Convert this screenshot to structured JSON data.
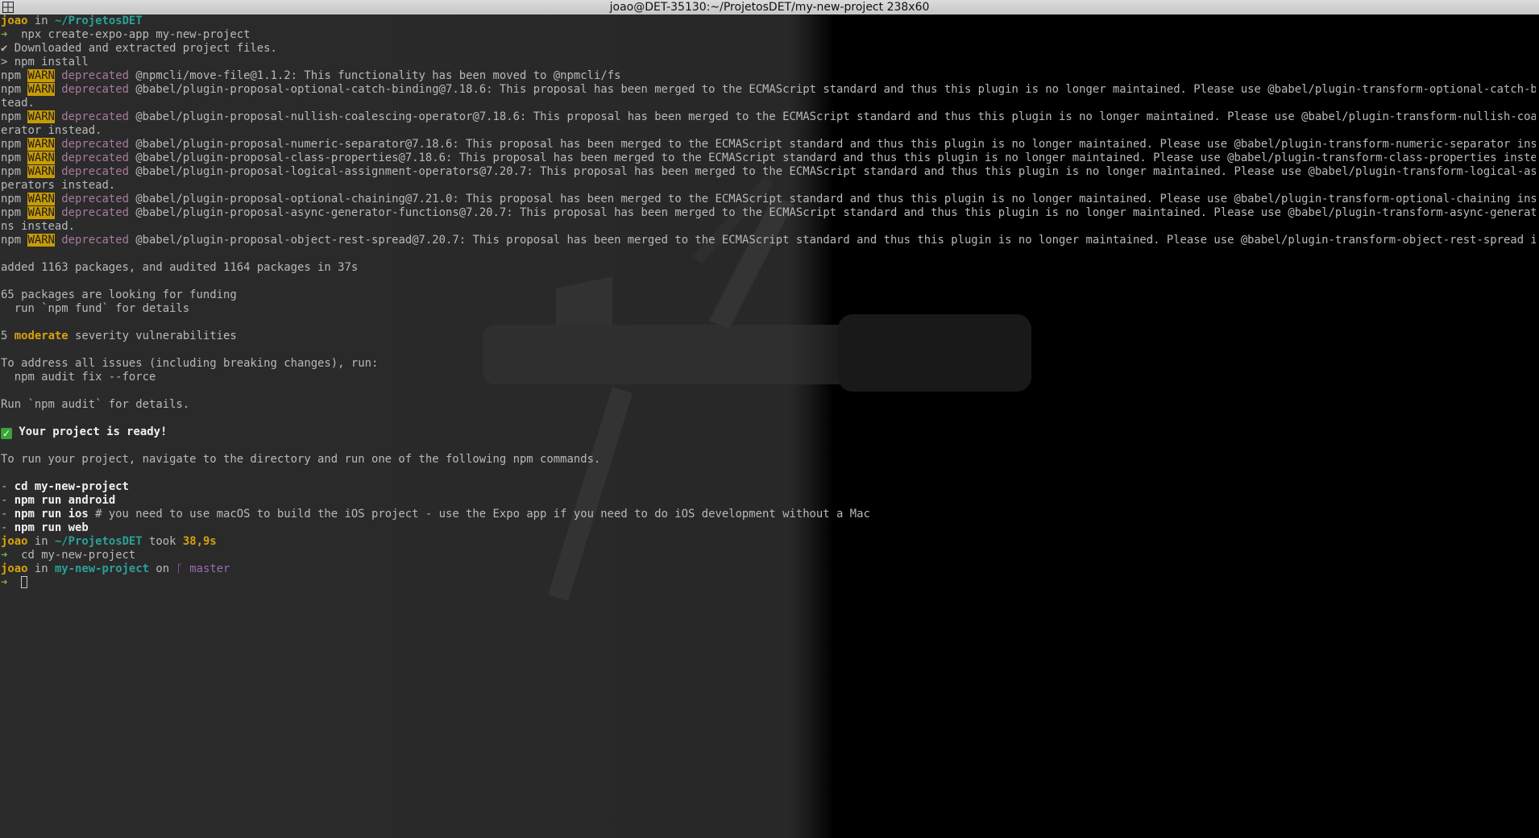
{
  "window": {
    "title": "joao@DET-35130:~/ProjetosDET/my-new-project 238x60"
  },
  "colors": {
    "prompt_user": "#d7a20a",
    "path": "#2aa198",
    "arrow": "#7fb04a",
    "warn_bg": "#c89b06",
    "deprecated": "#a87b9c",
    "branch": "#9b6bb3",
    "background": "#232323"
  },
  "prompt": {
    "user": "joao",
    "in_word": "in",
    "dir1": "~/ProjetosDET",
    "took_word": "took",
    "took_time": "38,9s",
    "dir2": "my-new-project",
    "on_word": "on",
    "branch_icon": "git-branch-icon",
    "branch": "master",
    "arrow": "➜"
  },
  "commands": {
    "create": "npx create-expo-app my-new-project",
    "cd": "cd my-new-project"
  },
  "output": {
    "downloaded": "✔ Downloaded and extracted project files.",
    "npm_install": "> npm install",
    "npm_prefix": "npm",
    "warn_label": "WARN",
    "deprecated_word": "deprecated",
    "warnings": [
      "@npmcli/move-file@1.1.2: This functionality has been moved to @npmcli/fs",
      "@babel/plugin-proposal-optional-catch-binding@7.18.6: This proposal has been merged to the ECMAScript standard and thus this plugin is no longer maintained. Please use @babel/plugin-transform-optional-catch-binding ins",
      "@babel/plugin-proposal-nullish-coalescing-operator@7.18.6: This proposal has been merged to the ECMAScript standard and thus this plugin is no longer maintained. Please use @babel/plugin-transform-nullish-coalescing-op",
      "@babel/plugin-proposal-numeric-separator@7.18.6: This proposal has been merged to the ECMAScript standard and thus this plugin is no longer maintained. Please use @babel/plugin-transform-numeric-separator instead.",
      "@babel/plugin-proposal-class-properties@7.18.6: This proposal has been merged to the ECMAScript standard and thus this plugin is no longer maintained. Please use @babel/plugin-transform-class-properties instead.",
      "@babel/plugin-proposal-logical-assignment-operators@7.20.7: This proposal has been merged to the ECMAScript standard and thus this plugin is no longer maintained. Please use @babel/plugin-transform-logical-assignment-o",
      "@babel/plugin-proposal-optional-chaining@7.21.0: This proposal has been merged to the ECMAScript standard and thus this plugin is no longer maintained. Please use @babel/plugin-transform-optional-chaining instead.",
      "@babel/plugin-proposal-async-generator-functions@7.20.7: This proposal has been merged to the ECMAScript standard and thus this plugin is no longer maintained. Please use @babel/plugin-transform-async-generator-functio",
      "@babel/plugin-proposal-object-rest-spread@7.20.7: This proposal has been merged to the ECMAScript standard and thus this plugin is no longer maintained. Please use @babel/plugin-transform-object-rest-spread instead."
    ],
    "wrap_tead": "tead.",
    "wrap_operator": "erator instead.",
    "wrap_operators": "perators instead.",
    "wrap_ns": "ns instead.",
    "added": "added 1163 packages, and audited 1164 packages in 37s",
    "funding": "65 packages are looking for funding",
    "fund_hint": "  run `npm fund` for details",
    "vuln_count": "5",
    "vuln_level": "moderate",
    "vuln_rest": "severity vulnerabilities",
    "address": "To address all issues (including breaking changes), run:",
    "audit_fix": "  npm audit fix --force",
    "run_audit": "Run `npm audit` for details.",
    "ready_icon": "check-mark-icon",
    "ready": "Your project is ready!",
    "to_run": "To run your project, navigate to the directory and run one of the following npm commands.",
    "dash": "- ",
    "cmd_cd": "cd my-new-project",
    "cmd_android": "npm run android",
    "cmd_ios": "npm run ios",
    "ios_comment": " # you need to use macOS to build the iOS project - use the Expo app if you need to do iOS development without a Mac",
    "cmd_web": "npm run web"
  }
}
